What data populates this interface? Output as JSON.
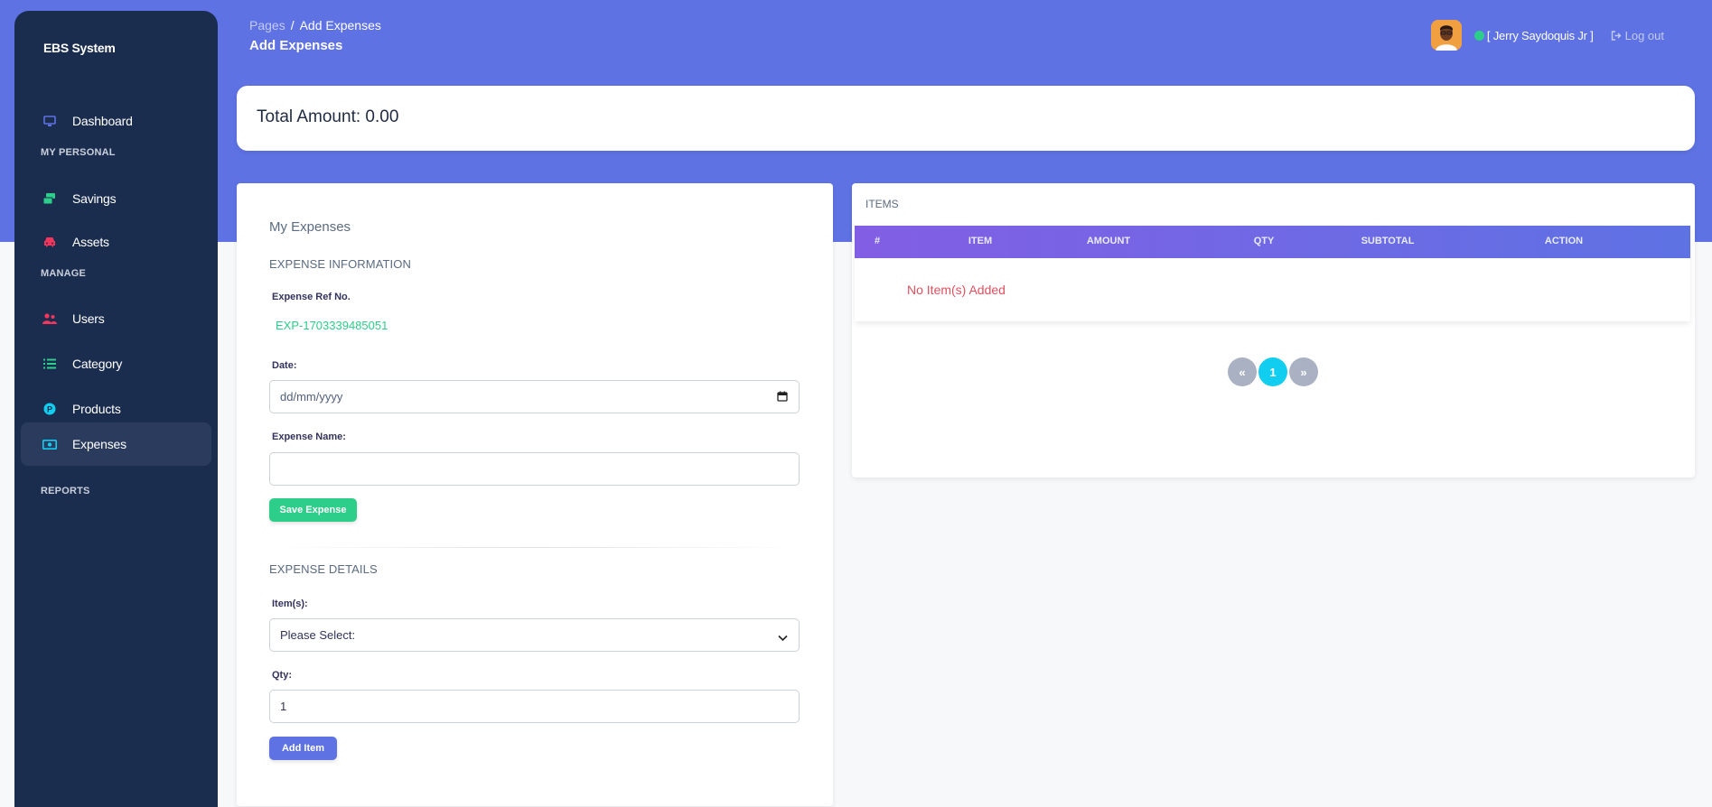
{
  "sidebar": {
    "brand": "EBS System",
    "items": [
      {
        "label": "Dashboard",
        "icon": "monitor-icon"
      },
      {
        "label": "Savings",
        "icon": "money-stack-icon"
      },
      {
        "label": "Assets",
        "icon": "car-icon"
      },
      {
        "label": "Users",
        "icon": "users-icon"
      },
      {
        "label": "Category",
        "icon": "list-icon"
      },
      {
        "label": "Products",
        "icon": "product-badge-icon"
      },
      {
        "label": "Expenses",
        "icon": "money-bill-icon"
      }
    ],
    "headings": {
      "personal": "MY PERSONAL",
      "manage": "MANAGE",
      "reports": "REPORTS"
    },
    "active_item": "Expenses"
  },
  "header": {
    "breadcrumb_root": "Pages",
    "breadcrumb_separator": "/",
    "breadcrumb_current": "Add Expenses",
    "title": "Add Expenses",
    "user_name": "[ Jerry Saydoquis Jr  ]",
    "logout_label": "Log out"
  },
  "summary": {
    "total_label": "Total Amount: 0.00"
  },
  "form": {
    "title": "My Expenses",
    "info_section": "EXPENSE INFORMATION",
    "ref_label": "Expense Ref No.",
    "ref_value": "EXP-1703339485051",
    "date_label": "Date:",
    "date_placeholder": "dd/mm/yyyy",
    "name_label": "Expense Name:",
    "name_value": "",
    "save_label": "Save Expense",
    "details_section": "EXPENSE DETAILS",
    "items_label": "Item(s):",
    "items_selected": "Please Select:",
    "qty_label": "Qty:",
    "qty_value": "1",
    "add_label": "Add Item"
  },
  "items_table": {
    "title": "ITEMS",
    "columns": [
      "#",
      "ITEM",
      "AMOUNT",
      "QTY",
      "SUBTOTAL",
      "ACTION"
    ],
    "empty_message": "No Item(s) Added",
    "pagination": {
      "prev": "«",
      "current": "1",
      "next": "»"
    }
  },
  "colors": {
    "primary": "#5e72e4",
    "sidebar": "#1b2d4f",
    "success": "#2dce89",
    "danger": "#e0505f",
    "info": "#11cdef"
  }
}
